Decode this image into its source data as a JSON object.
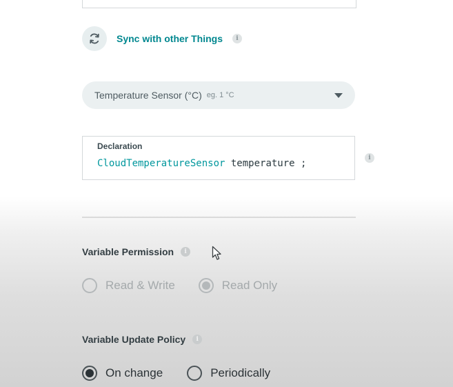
{
  "sync": {
    "label": "Sync with other Things",
    "icon": "sync-icon"
  },
  "variable_type": {
    "selected": "Temperature Sensor (°C)",
    "example": "eg. 1 °C"
  },
  "declaration": {
    "title": "Declaration",
    "type_name": "CloudTemperatureSensor",
    "rest": " temperature ;"
  },
  "permission": {
    "title": "Variable Permission",
    "options": [
      {
        "label": "Read & Write",
        "selected": false
      },
      {
        "label": "Read Only",
        "selected": true
      }
    ]
  },
  "update_policy": {
    "title": "Variable Update Policy",
    "options": [
      {
        "label": "On change",
        "selected": true
      },
      {
        "label": "Periodically",
        "selected": false
      }
    ]
  },
  "colors": {
    "accent": "#00878f",
    "code_type": "#00979d"
  }
}
